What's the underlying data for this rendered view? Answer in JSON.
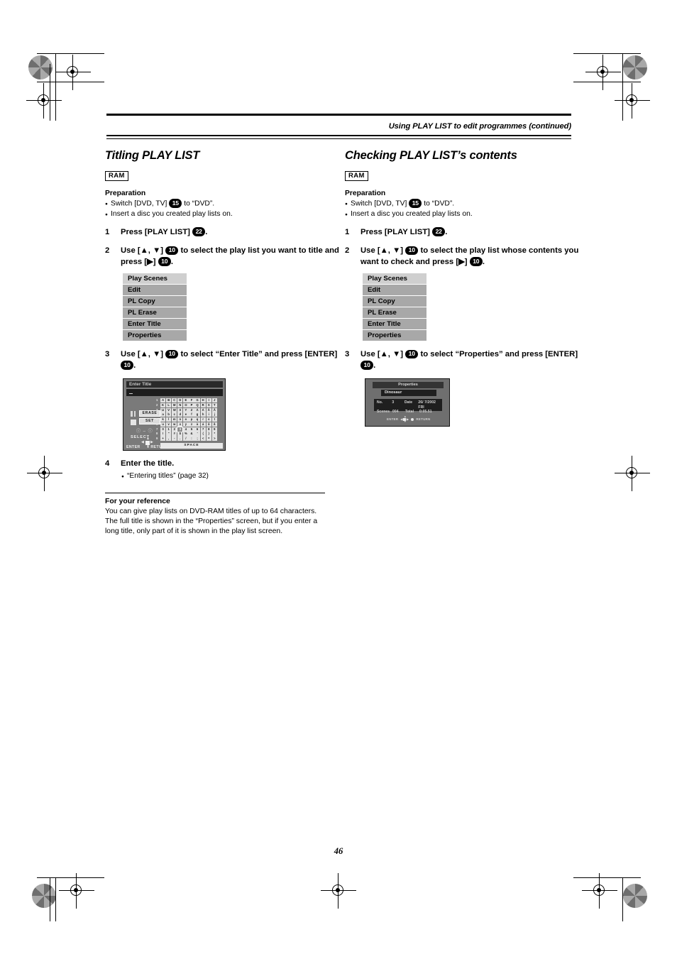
{
  "header": {
    "running_title": "Using PLAY LIST to edit programmes (continued)"
  },
  "page_number": "46",
  "left_column": {
    "section_title": "Titling PLAY LIST",
    "media_badge": "RAM",
    "preparation_heading": "Preparation",
    "preparation_items": [
      {
        "pre": "Switch [DVD, TV] ",
        "key": "15",
        "post": " to “DVD”."
      },
      {
        "pre": "Insert a disc you created play lists on.",
        "key": "",
        "post": ""
      }
    ],
    "steps": [
      {
        "num": "1",
        "text_parts": [
          "Press [PLAY LIST] ",
          "22",
          "."
        ],
        "key": "22"
      },
      {
        "num": "2",
        "line1_a": "Use [▲, ▼] ",
        "line1_key": "10",
        "line1_b": " to select the play list you want to",
        "line2_a": "title and press [▶] ",
        "line2_key": "10",
        "line2_b": "."
      },
      {
        "num": "3",
        "line1_a": "Use [▲, ▼] ",
        "line1_key": "10",
        "line1_b": " to select “Enter Title” and press",
        "line2_a": "[ENTER] ",
        "line2_key": "10",
        "line2_b": "."
      },
      {
        "num": "4",
        "title": "Enter the title.",
        "bullet": "“Entering titles” (page 32)"
      }
    ],
    "menu": {
      "items": [
        {
          "label": "Play Scenes",
          "highlighted": true
        },
        {
          "label": "Edit",
          "highlighted": false
        },
        {
          "label": "PL Copy",
          "highlighted": false
        },
        {
          "label": "PL Erase",
          "highlighted": false
        },
        {
          "label": "Enter Title",
          "highlighted": false
        },
        {
          "label": "Properties",
          "highlighted": false
        }
      ]
    },
    "enter_title_screen": {
      "title": "Enter Title",
      "erase_button": "ERASE",
      "set_button": "SET",
      "skip_label": "ⓘ – ⓘ",
      "select_label": "SELECT",
      "enter_label": "ENTER",
      "return_label": "RETURN",
      "space_label": "SPACE",
      "row_labels": [
        "1",
        "2",
        "3",
        "4",
        "5",
        "6",
        "7",
        "8",
        "9",
        "0",
        "←"
      ],
      "grid_rows": [
        [
          "A",
          "B",
          "C",
          "D",
          "E",
          "F",
          "G",
          "H",
          "I",
          "J"
        ],
        [
          "K",
          "L",
          "M",
          "N",
          "O",
          "P",
          "Q",
          "R",
          "S",
          "T"
        ],
        [
          "U",
          "V",
          "W",
          "X",
          "Y",
          "Z",
          "À",
          "Á",
          "Â",
          "Ã"
        ],
        [
          "a",
          "b",
          "c",
          "d",
          "e",
          "f",
          "g",
          "h",
          "i",
          "j"
        ],
        [
          "k",
          "l",
          "m",
          "n",
          "o",
          "p",
          "q",
          "r",
          "s",
          "t"
        ],
        [
          "u",
          "v",
          "w",
          "x",
          "y",
          "z",
          "à",
          "á",
          "â",
          "ã"
        ],
        [
          "0",
          "1",
          "2",
          "3",
          "4",
          "5",
          "6",
          "7",
          "8",
          "9"
        ],
        [
          "!",
          "\"",
          "#",
          "$",
          "%",
          "&",
          "'",
          "(",
          ")",
          "*"
        ],
        [
          "+",
          ",",
          "-",
          ".",
          "/",
          ":",
          ";",
          "<",
          "=",
          ">"
        ]
      ],
      "selected_cell": {
        "row": 6,
        "col": 3
      }
    },
    "reference": {
      "heading": "For your reference",
      "body": "You can give play lists on DVD-RAM titles of up to 64 characters. The full title is shown in the “Properties” screen, but if you enter a long title, only part of it is shown in the play list screen."
    }
  },
  "right_column": {
    "section_title": "Checking PLAY LIST’s contents",
    "media_badge": "RAM",
    "preparation_heading": "Preparation",
    "preparation_items": [
      {
        "pre": "Switch [DVD, TV] ",
        "key": "15",
        "post": " to “DVD”."
      },
      {
        "pre": "Insert a disc you created play lists on.",
        "key": "",
        "post": ""
      }
    ],
    "steps": [
      {
        "num": "1",
        "text_parts": [
          "Press [PLAY LIST] ",
          "22",
          "."
        ],
        "key": "22"
      },
      {
        "num": "2",
        "line1_a": "Use [▲, ▼] ",
        "line1_key": "10",
        "line1_b": " to select the play list whose",
        "line2_a": "contents you want to check and press [▶] ",
        "line2_key": "10",
        "line2_b": "."
      },
      {
        "num": "3",
        "line1_a": "Use [▲, ▼] ",
        "line1_key": "10",
        "line1_b": " to select “Properties” and press",
        "line2_a": "[ENTER] ",
        "line2_key": "10",
        "line2_b": "."
      }
    ],
    "menu": {
      "items": [
        {
          "label": "Play Scenes",
          "highlighted": true
        },
        {
          "label": "Edit",
          "highlighted": false
        },
        {
          "label": "PL Copy",
          "highlighted": false
        },
        {
          "label": "PL Erase",
          "highlighted": false
        },
        {
          "label": "Enter Title",
          "highlighted": false
        },
        {
          "label": "Properties",
          "highlighted": false
        }
      ]
    },
    "properties_screen": {
      "title": "Properties",
      "playlist_name": "Dinosaur",
      "no_label": "No.",
      "no_value": "3",
      "date_label": "Date",
      "date_value": "26/ 7/2002 FRI",
      "scenes_label": "Scenes",
      "scenes_value": "004",
      "total_label": "Total",
      "total_value": "0:05.51",
      "enter_label": "ENTER",
      "return_label": "RETURN"
    }
  }
}
